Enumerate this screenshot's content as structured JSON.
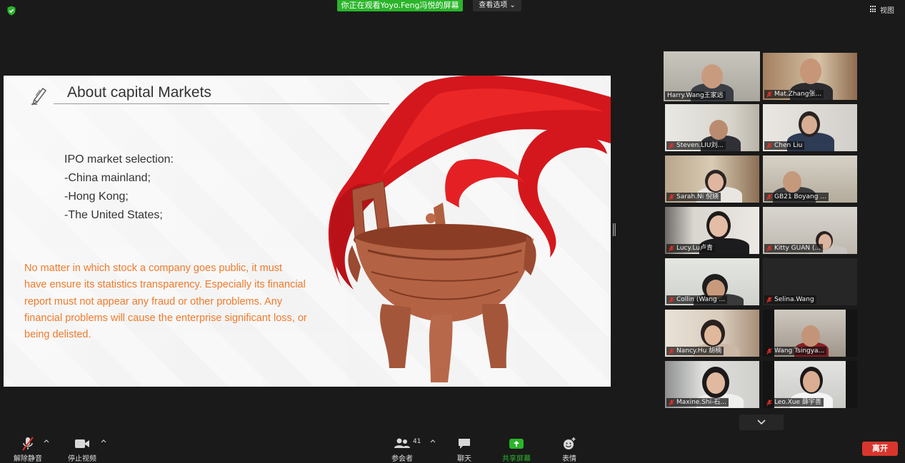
{
  "top_bar": {
    "banner": "你正在观看Yoyo.Feng冯悦的屏幕",
    "view_options": "查看选项 ⌄",
    "view_button": "视图"
  },
  "slide": {
    "title": "About capital Markets",
    "ipo_lines": [
      "IPO market selection:",
      "-China mainland;",
      "-Hong Kong;",
      "-The United States;"
    ],
    "paragraph_lines": [
      "No matter in which stock a company goes public, it must",
      "have ensure its statistics transparency. Especially its financial",
      "report must not appear any fraud or other problems. Any",
      "financial problems will cause the enterprise significant loss, or",
      "being delisted."
    ],
    "accent_color": "#f07a2c"
  },
  "participants": [
    {
      "name": "Harry.Wang王家远",
      "muted": false,
      "active": true
    },
    {
      "name": "Mat.Zhang张...",
      "muted": true
    },
    {
      "name": "Steven.LIU刘...",
      "muted": true
    },
    {
      "name": "Chen Liu",
      "muted": true
    },
    {
      "name": "Sarah.Ni 倪娆",
      "muted": true
    },
    {
      "name": "GB21 Boyang ...",
      "muted": true
    },
    {
      "name": "Lucy.Lu卢青",
      "muted": true
    },
    {
      "name": "Kitty GUAN (...",
      "muted": true
    },
    {
      "name": "Collin (Wang ...",
      "muted": true
    },
    {
      "name": "Selina.Wang",
      "muted": true
    },
    {
      "name": "Nancy.Hu 胡楠",
      "muted": true
    },
    {
      "name": "Wang Tsingya...",
      "muted": true
    },
    {
      "name": "Maxine.Shi-石...",
      "muted": true
    },
    {
      "name": "Leo.Xue 薛宇善",
      "muted": true
    }
  ],
  "toolbar": {
    "unmute": "解除静音",
    "stop_video": "停止视频",
    "participants": "参会者",
    "participant_count": "41",
    "chat": "聊天",
    "share_screen": "共享屏幕",
    "reactions": "表情",
    "leave": "离开"
  },
  "colors": {
    "active_speaker": "#bfe13a",
    "share_green": "#2ab52a",
    "leave_red": "#d8362d",
    "muted_mic": "#e0312a"
  }
}
